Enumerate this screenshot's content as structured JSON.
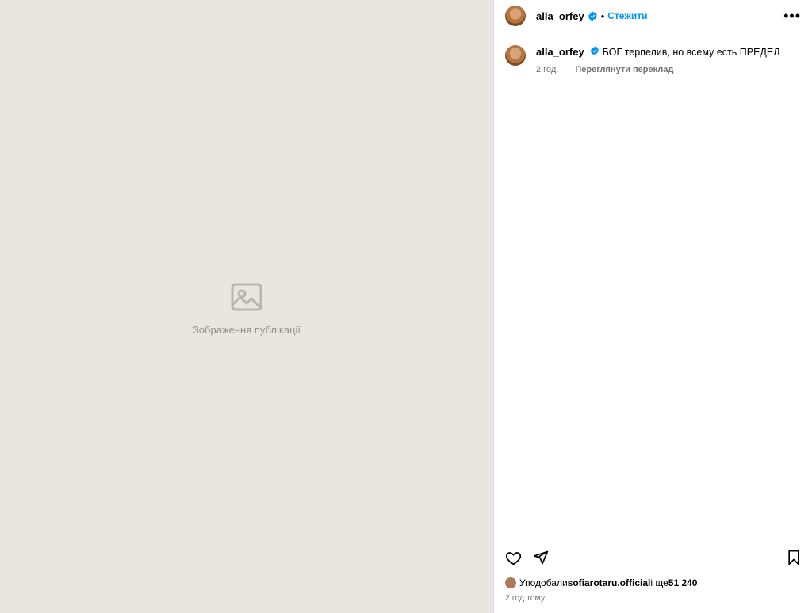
{
  "media": {
    "placeholder": "Зображення публікації"
  },
  "header": {
    "username": "alla_orfey",
    "separator": "•",
    "follow_label": "Стежити"
  },
  "caption": {
    "username": "alla_orfey",
    "text": "БОГ терпелив, но всему есть ПРЕДЕЛ",
    "time": "2 год.",
    "translate_label": "Переглянути переклад"
  },
  "likes": {
    "prefix": "Уподобали ",
    "user": "sofiarotaru.official",
    "suffix": " і ще ",
    "count": "51 240"
  },
  "time_ago": "2 год тому",
  "colors": {
    "accent": "#0095f6",
    "verified": "#0095f6"
  },
  "icons": [
    "verified-icon",
    "more-icon",
    "heart-icon",
    "share-icon",
    "bookmark-icon"
  ]
}
